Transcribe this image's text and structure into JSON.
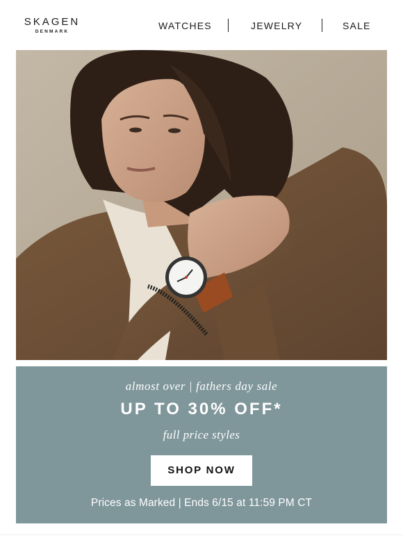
{
  "brand": {
    "logo_main": "SKAGEN",
    "logo_sub": "DENMARK"
  },
  "nav": {
    "items": [
      {
        "label": "WATCHES"
      },
      {
        "label": "JEWELRY"
      },
      {
        "label": "SALE"
      }
    ]
  },
  "hero": {
    "image": "man-wearing-watch-photo"
  },
  "promo": {
    "eyebrow": "almost over | fathers day sale",
    "headline": "UP TO 30% OFF*",
    "sub": "full price styles",
    "cta_label": "SHOP NOW",
    "terms": "Prices as Marked | Ends 6/15 at 11:59 PM CT",
    "background": "#7f969b"
  }
}
